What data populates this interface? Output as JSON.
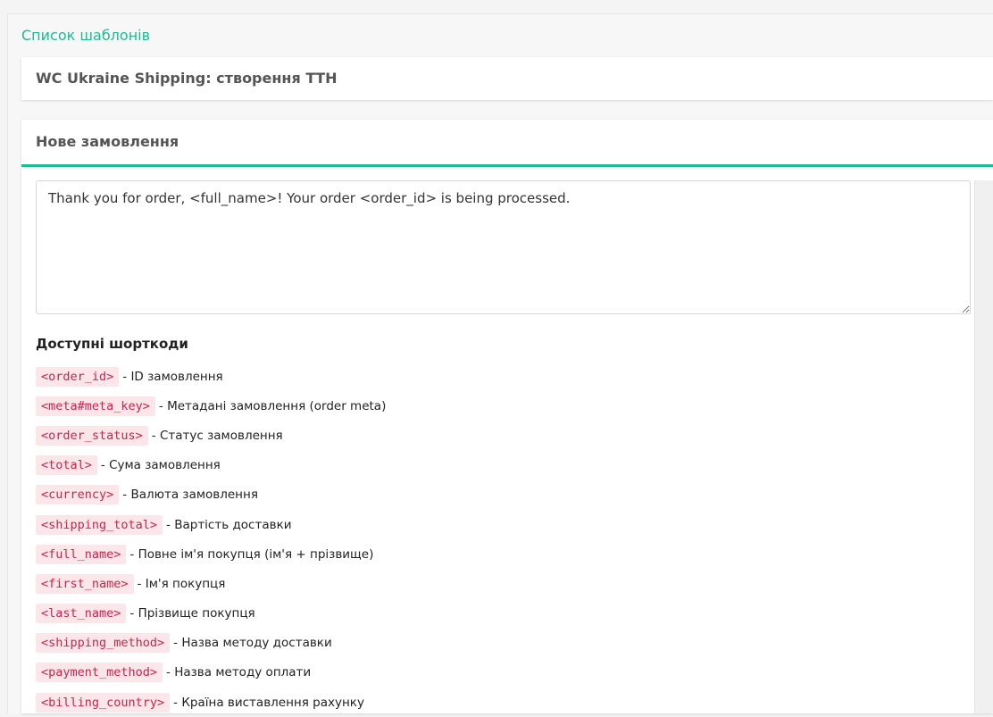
{
  "nav": {
    "back_link": "Список шаблонів"
  },
  "header": {
    "title": "WC Ukraine Shipping: створення ТТН"
  },
  "section": {
    "title": "Нове замовлення",
    "message_value": "Thank you for order, <full_name>! Your order <order_id> is being processed."
  },
  "shortcodes": {
    "title": "Доступні шорткоди",
    "items": [
      {
        "code": "<order_id>",
        "desc": "- ID замовлення"
      },
      {
        "code": "<meta#meta_key>",
        "desc": "- Метадані замовлення (order meta)"
      },
      {
        "code": "<order_status>",
        "desc": "- Статус замовлення"
      },
      {
        "code": "<total>",
        "desc": "- Сума замовлення"
      },
      {
        "code": "<currency>",
        "desc": "- Валюта замовлення"
      },
      {
        "code": "<shipping_total>",
        "desc": "- Вартість доставки"
      },
      {
        "code": "<full_name>",
        "desc": "- Повне ім'я покупця (ім'я + прізвище)"
      },
      {
        "code": "<first_name>",
        "desc": "- Ім'я покупця"
      },
      {
        "code": "<last_name>",
        "desc": "- Прізвище покупця"
      },
      {
        "code": "<shipping_method>",
        "desc": "- Назва методу доставки"
      },
      {
        "code": "<payment_method>",
        "desc": "- Назва методу оплати"
      },
      {
        "code": "<billing_country>",
        "desc": "- Країна виставлення рахунку"
      }
    ]
  },
  "colors": {
    "accent": "#1fbb94",
    "code_bg": "#fbe7e9",
    "code_text": "#c7254e"
  }
}
